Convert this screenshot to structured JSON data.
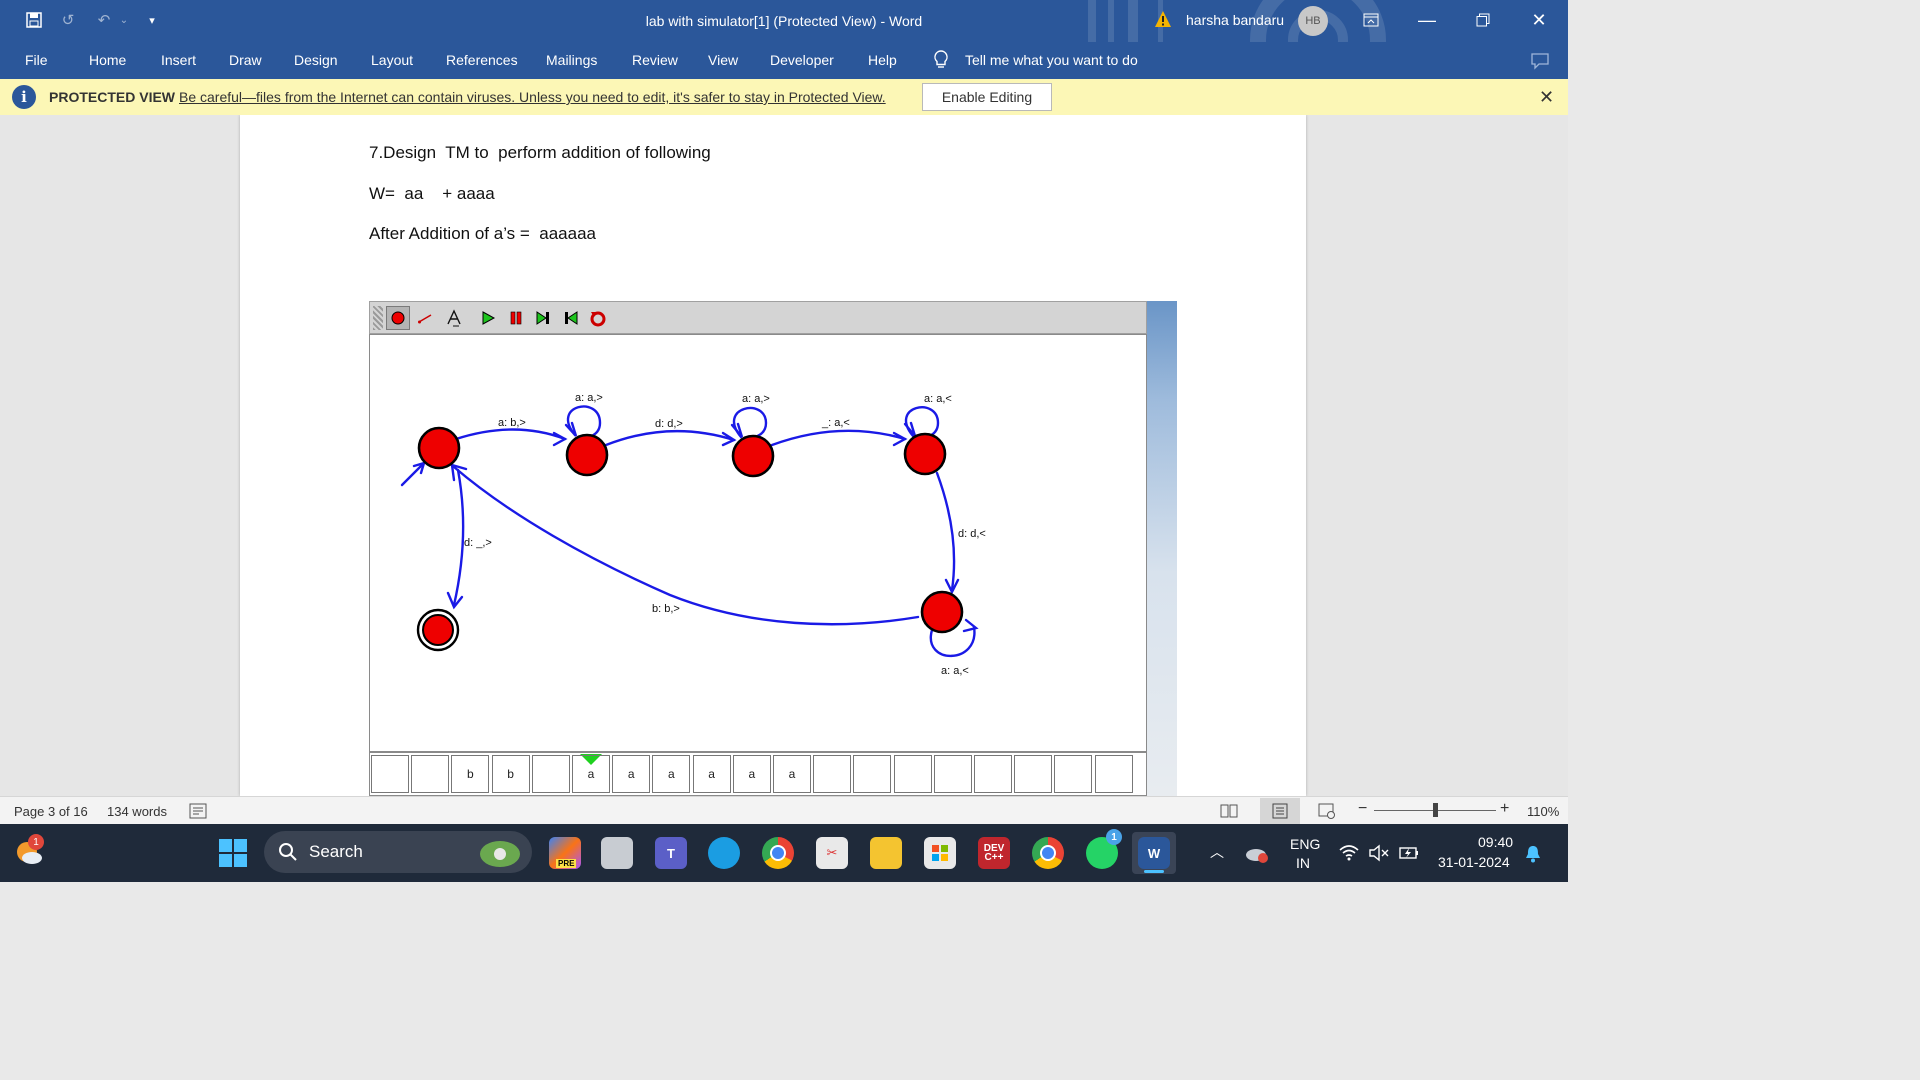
{
  "titlebar": {
    "title": "lab with simulator[1] (Protected View)  -  Word",
    "user_name": "harsha bandaru",
    "user_initials": "HB"
  },
  "ribbon": {
    "tabs": [
      "File",
      "Home",
      "Insert",
      "Draw",
      "Design",
      "Layout",
      "References",
      "Mailings",
      "Review",
      "View",
      "Developer",
      "Help"
    ],
    "tell_me": "Tell me what you want to do"
  },
  "protected_view": {
    "label": "PROTECTED VIEW",
    "message": "Be careful—files from the Internet can contain viruses. Unless you need to edit, it's safer to stay in Protected View.",
    "button": "Enable Editing"
  },
  "document": {
    "heading": "7.Design  TM to  perform addition of following",
    "line2": "W=  aa    + aaaa",
    "line3": "After Addition of a’s =  aaaaaa"
  },
  "simulator": {
    "transitions": {
      "t01": "a: b,>",
      "loop1": "a: a,>",
      "t12": "d: d,>",
      "loop2": "a: a,>",
      "t23": "_: a,<",
      "loop3": "a: a,<",
      "t34": "d: d,<",
      "loop4": "a: a,<",
      "t40": "b: b,>",
      "t0f": "d: _,>"
    },
    "tape": [
      "",
      "",
      "b",
      "b",
      "",
      "a",
      "a",
      "a",
      "a",
      "a",
      "a",
      "",
      "",
      "",
      "",
      "",
      "",
      "",
      ""
    ],
    "head_index": 5
  },
  "statusbar": {
    "page": "Page 3 of 16",
    "words": "134 words",
    "zoom": "110%"
  },
  "taskbar": {
    "search": "Search",
    "lang_line1": "ENG",
    "lang_line2": "IN",
    "time": "09:40",
    "date": "31-01-2024",
    "weather_badge": "1",
    "whatsapp_badge": "1"
  }
}
